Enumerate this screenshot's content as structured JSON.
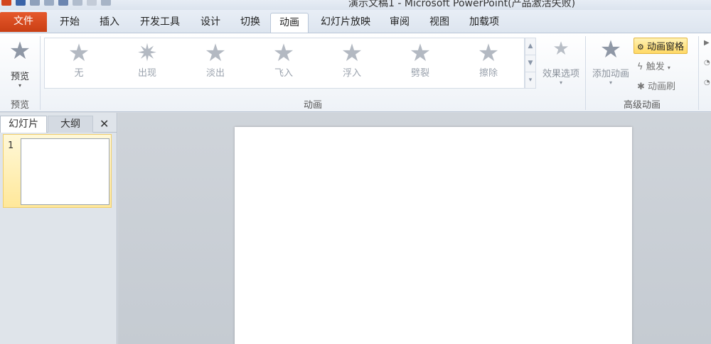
{
  "window": {
    "title": "演示文稿1 - Microsoft PowerPoint(产品激活失败)"
  },
  "tabs": [
    {
      "label": "文件"
    },
    {
      "label": "开始"
    },
    {
      "label": "插入"
    },
    {
      "label": "开发工具"
    },
    {
      "label": "设计"
    },
    {
      "label": "切换"
    },
    {
      "label": "动画"
    },
    {
      "label": "幻灯片放映"
    },
    {
      "label": "审阅"
    },
    {
      "label": "视图"
    },
    {
      "label": "加载项"
    }
  ],
  "ribbon": {
    "preview": {
      "label": "预览",
      "group_label": "预览"
    },
    "animations": {
      "group_label": "动画",
      "items": [
        {
          "label": "无"
        },
        {
          "label": "出现"
        },
        {
          "label": "淡出"
        },
        {
          "label": "飞入"
        },
        {
          "label": "浮入"
        },
        {
          "label": "劈裂"
        },
        {
          "label": "擦除"
        }
      ],
      "effect_options": "效果选项"
    },
    "advanced": {
      "group_label": "高级动画",
      "add_animation": "添加动画",
      "animation_pane": "动画窗格",
      "trigger": "触发",
      "animation_painter": "动画刷"
    }
  },
  "left_pane": {
    "tabs": [
      {
        "label": "幻灯片"
      },
      {
        "label": "大纲"
      }
    ],
    "close": "✕",
    "slides": [
      {
        "number": "1"
      }
    ]
  },
  "colors": {
    "file_tab": "#d2451e",
    "active_highlight": "#ffd965"
  }
}
